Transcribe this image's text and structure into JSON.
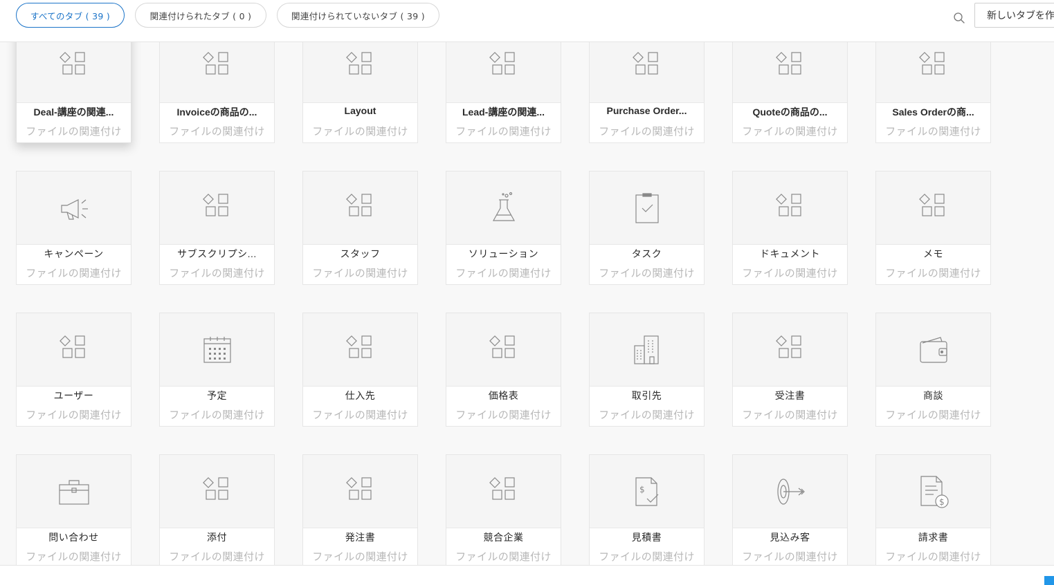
{
  "filters": [
    {
      "label": "すべてのタブ ( 39 )",
      "active": true
    },
    {
      "label": "関連付けられたタブ ( 0 )",
      "active": false
    },
    {
      "label": "関連付けられていないタブ ( 39 )",
      "active": false
    }
  ],
  "search_icon": "search-icon",
  "new_tab_label": "新しいタブを作",
  "accent_color": "#1a73c8",
  "cards": [
    {
      "name": "Deal-講座の関連...",
      "sub": "ファイルの関連付け",
      "icon": "module"
    },
    {
      "name": "Invoiceの商品の...",
      "sub": "ファイルの関連付け",
      "icon": "module"
    },
    {
      "name": "Layout",
      "sub": "ファイルの関連付け",
      "icon": "module"
    },
    {
      "name": "Lead-講座の関連...",
      "sub": "ファイルの関連付け",
      "icon": "module"
    },
    {
      "name": "Purchase Order...",
      "sub": "ファイルの関連付け",
      "icon": "module"
    },
    {
      "name": "Quoteの商品の...",
      "sub": "ファイルの関連付け",
      "icon": "module"
    },
    {
      "name": "Sales Orderの商...",
      "sub": "ファイルの関連付け",
      "icon": "module"
    },
    {
      "name": "キャンペーン",
      "sub": "ファイルの関連付け",
      "icon": "megaphone"
    },
    {
      "name": "サブスクリプシ...",
      "sub": "ファイルの関連付け",
      "icon": "module"
    },
    {
      "name": "スタッフ",
      "sub": "ファイルの関連付け",
      "icon": "module"
    },
    {
      "name": "ソリューション",
      "sub": "ファイルの関連付け",
      "icon": "flask"
    },
    {
      "name": "タスク",
      "sub": "ファイルの関連付け",
      "icon": "clipboard"
    },
    {
      "name": "ドキュメント",
      "sub": "ファイルの関連付け",
      "icon": "module"
    },
    {
      "name": "メモ",
      "sub": "ファイルの関連付け",
      "icon": "module"
    },
    {
      "name": "ユーザー",
      "sub": "ファイルの関連付け",
      "icon": "module"
    },
    {
      "name": "予定",
      "sub": "ファイルの関連付け",
      "icon": "calendar"
    },
    {
      "name": "仕入先",
      "sub": "ファイルの関連付け",
      "icon": "module"
    },
    {
      "name": "価格表",
      "sub": "ファイルの関連付け",
      "icon": "module"
    },
    {
      "name": "取引先",
      "sub": "ファイルの関連付け",
      "icon": "building"
    },
    {
      "name": "受注書",
      "sub": "ファイルの関連付け",
      "icon": "module"
    },
    {
      "name": "商談",
      "sub": "ファイルの関連付け",
      "icon": "wallet"
    },
    {
      "name": "問い合わせ",
      "sub": "ファイルの関連付け",
      "icon": "briefcase"
    },
    {
      "name": "添付",
      "sub": "ファイルの関連付け",
      "icon": "module"
    },
    {
      "name": "発注書",
      "sub": "ファイルの関連付け",
      "icon": "module"
    },
    {
      "name": "競合企業",
      "sub": "ファイルの関連付け",
      "icon": "module"
    },
    {
      "name": "見積書",
      "sub": "ファイルの関連付け",
      "icon": "quote-doc"
    },
    {
      "name": "見込み客",
      "sub": "ファイルの関連付け",
      "icon": "target"
    },
    {
      "name": "請求書",
      "sub": "ファイルの関連付け",
      "icon": "invoice-doc"
    }
  ]
}
